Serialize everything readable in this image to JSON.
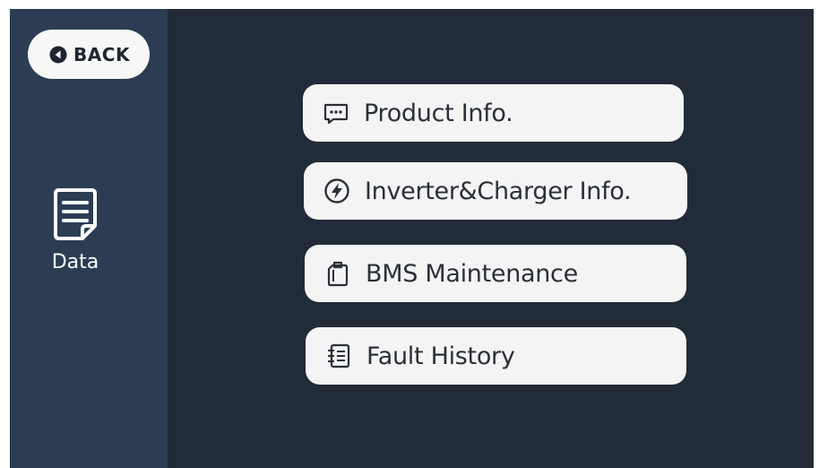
{
  "back": {
    "label": "BACK",
    "icon": "back-circle-icon"
  },
  "sidebar": {
    "nav": {
      "label": "Data",
      "icon": "document-icon"
    }
  },
  "menu": {
    "items": [
      {
        "label": "Product Info.",
        "icon": "message-dots-icon"
      },
      {
        "label": "Inverter&Charger Info.",
        "icon": "lightning-icon"
      },
      {
        "label": "BMS Maintenance",
        "icon": "clipboard-icon"
      },
      {
        "label": "Fault History",
        "icon": "list-icon"
      }
    ]
  },
  "colors": {
    "screen_background": "#222b38",
    "sidebar_background": "#2c3d53",
    "button_background": "#f4f4f4",
    "button_text": "#2a2f38"
  }
}
